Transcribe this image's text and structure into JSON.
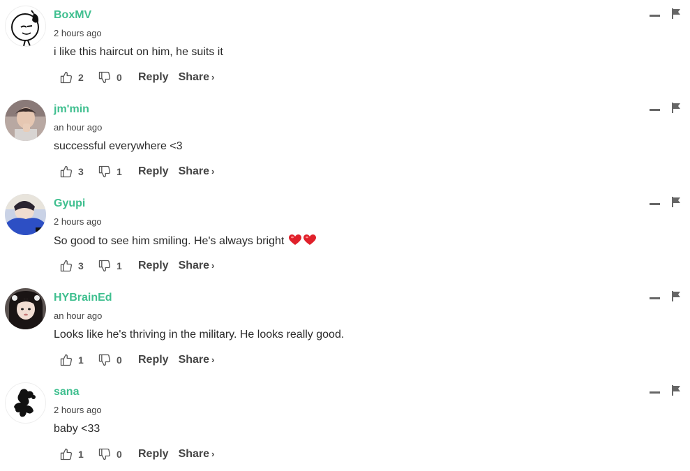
{
  "labels": {
    "reply": "Reply",
    "share": "Share",
    "share_chevron": "›"
  },
  "colors": {
    "username": "#3fbf8f",
    "heart": "#e0202a"
  },
  "comments": [
    {
      "username": "BoxMV",
      "timestamp": "2 hours ago",
      "text": "i like this haircut on him, he suits it",
      "upvotes": "2",
      "downvotes": "0",
      "avatar_icon": "sketch-avatar-icon"
    },
    {
      "username": "jm'min",
      "timestamp": "an hour ago",
      "text": "successful everywhere <3",
      "upvotes": "3",
      "downvotes": "1",
      "avatar_icon": "photo-avatar-icon"
    },
    {
      "username": "Gyupi",
      "timestamp": "2 hours ago",
      "text": "So good to see him smiling. He's always bright",
      "emoji": "❤️ ❤️",
      "upvotes": "3",
      "downvotes": "1",
      "avatar_icon": "photo-avatar-icon"
    },
    {
      "username": "HYBrainEd",
      "timestamp": "an hour ago",
      "text": "Looks like he's thriving in the military. He looks really good.",
      "upvotes": "1",
      "downvotes": "0",
      "avatar_icon": "photo-avatar-icon"
    },
    {
      "username": "sana",
      "timestamp": "2 hours ago",
      "text": "baby <33",
      "upvotes": "1",
      "downvotes": "0",
      "avatar_icon": "silhouette-avatar-icon"
    }
  ]
}
